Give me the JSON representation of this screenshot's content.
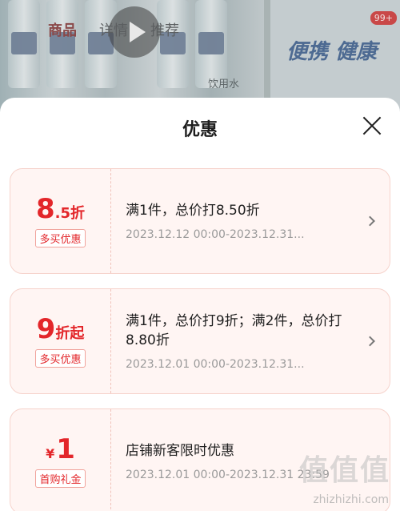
{
  "background": {
    "tabs": [
      "商品",
      "详情",
      "推荐"
    ],
    "cart_badge": "99+",
    "banner_text": "便携 健康",
    "bottom_text": "饮用水"
  },
  "sheet": {
    "title": "优惠",
    "coupons": [
      {
        "amount_big": "8",
        "amount_small": ".5折",
        "tag": "多买优惠",
        "desc": "满1件，总价打8.50折",
        "date": "2023.12.12 00:00-2023.12.31..."
      },
      {
        "amount_big": "9",
        "amount_small": "折起",
        "tag": "多买优惠",
        "desc": "满1件，总价打9折；满2件，总价打8.80折",
        "date": "2023.12.01 00:00-2023.12.31..."
      },
      {
        "amount_currency": "¥",
        "amount_big": "1",
        "tag": "首购礼金",
        "desc": "店铺新客限时优惠",
        "date": "2023.12.01 00:00-2023.12.31 23:59"
      }
    ]
  },
  "watermark": {
    "main": "值值值",
    "sub": "zhizhizhi.com"
  }
}
